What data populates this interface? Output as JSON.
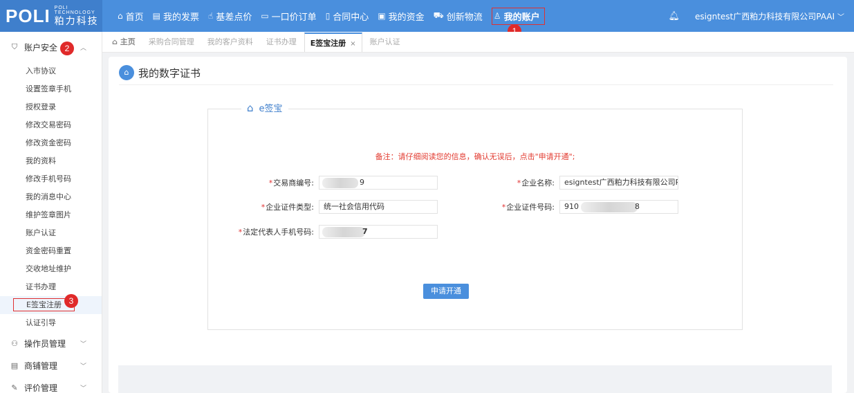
{
  "header": {
    "logo_text": "POLI",
    "logo_sub_top": "POLI",
    "logo_sub_mid": "TECHNOLOGY",
    "logo_cn": "粕力科技",
    "nav": [
      {
        "label": "首页",
        "icon": "home-icon"
      },
      {
        "label": "我的发票",
        "icon": "invoice-icon"
      },
      {
        "label": "基差点价",
        "icon": "hand-icon"
      },
      {
        "label": "一口价订单",
        "icon": "order-icon"
      },
      {
        "label": "合同中心",
        "icon": "document-icon"
      },
      {
        "label": "我的资金",
        "icon": "wallet-icon"
      },
      {
        "label": "创新物流",
        "icon": "truck-icon"
      },
      {
        "label": "我的账户",
        "icon": "user-icon"
      }
    ],
    "user_name": "esigntest广西粕力科技有限公司PAAI"
  },
  "annotations": [
    "1",
    "2",
    "3"
  ],
  "sidebar": {
    "group_account": "账户安全",
    "items": [
      "入市协议",
      "设置签章手机",
      "授权登录",
      "修改交易密码",
      "修改资金密码",
      "我的资料",
      "修改手机号码",
      "我的消息中心",
      "维护签章图片",
      "账户认证",
      "资金密码重置",
      "交收地址维护",
      "证书办理",
      "E签宝注册",
      "认证引导"
    ],
    "groups_after": [
      "操作员管理",
      "商铺管理",
      "评价管理"
    ]
  },
  "tabs": [
    "主页",
    "采购合同管理",
    "我的客户资料",
    "证书办理",
    "E签宝注册",
    "账户认证"
  ],
  "page": {
    "title": "我的数字证书",
    "legend": "e签宝",
    "notice": "备注：请仔细阅读您的信息，确认无误后，点击\"申请开通\";",
    "fields": {
      "trader_no_label": "交易商编号:",
      "trader_no_value": "9",
      "company_name_label": "企业名称:",
      "company_name_value": "esigntest广西粕力科技有限公司PA",
      "cert_type_label": "企业证件类型:",
      "cert_type_value": "统一社会信用代码",
      "cert_no_label": "企业证件号码:",
      "cert_no_value_prefix": "910",
      "cert_no_value_suffix": "8",
      "phone_label": "法定代表人手机号码:",
      "phone_value": "7"
    },
    "submit_label": "申请开通",
    "required_mark": "*"
  },
  "colors": {
    "primary": "#4a8fdd",
    "alert": "#e02a2a"
  }
}
